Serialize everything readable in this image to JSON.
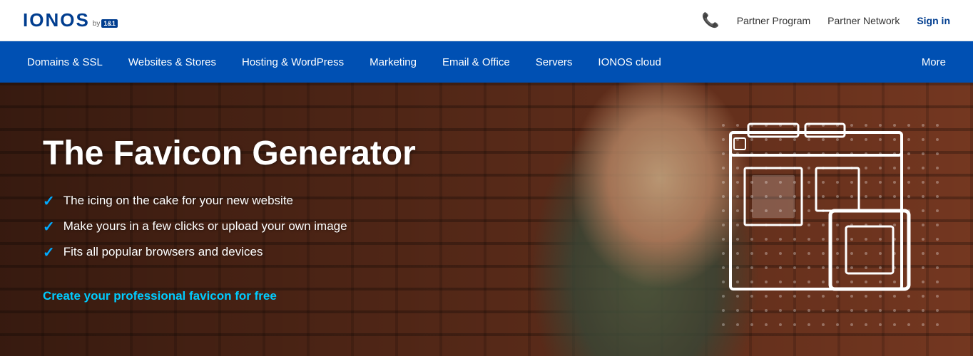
{
  "topbar": {
    "logo_text": "IONOS",
    "logo_by": "by",
    "logo_badge": "1&1",
    "phone_icon": "📞",
    "partner_program": "Partner Program",
    "partner_network": "Partner Network",
    "signin": "Sign in"
  },
  "nav": {
    "items": [
      {
        "label": "Domains & SSL",
        "id": "domains"
      },
      {
        "label": "Websites & Stores",
        "id": "websites"
      },
      {
        "label": "Hosting & WordPress",
        "id": "hosting"
      },
      {
        "label": "Marketing",
        "id": "marketing"
      },
      {
        "label": "Email & Office",
        "id": "email"
      },
      {
        "label": "Servers",
        "id": "servers"
      },
      {
        "label": "IONOS cloud",
        "id": "cloud"
      }
    ],
    "more": "More"
  },
  "hero": {
    "title": "The Favicon Generator",
    "bullets": [
      "The icing on the cake for your new website",
      "Make yours in a few clicks or upload your own image",
      "Fits all popular browsers and devices"
    ],
    "cta": "Create your professional favicon for free"
  }
}
